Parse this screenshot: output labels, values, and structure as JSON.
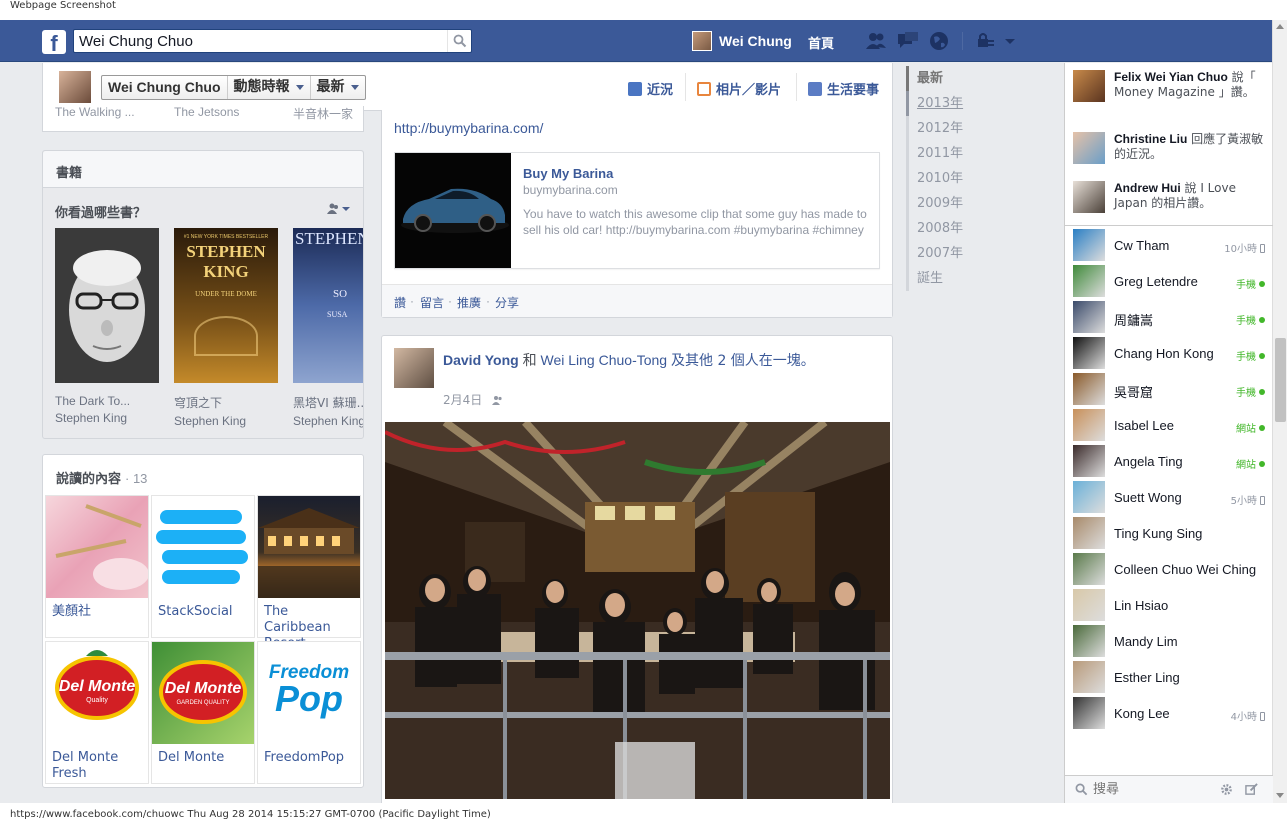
{
  "caption": "Webpage Screenshot",
  "statusline": "https://www.facebook.com/chuowc Thu Aug 28 2014 15:15:27 GMT-0700 (Pacific Daylight Time)",
  "colors": {
    "brand_blue": "#3b5998",
    "link": "#3b5998",
    "online_green": "#42b72a"
  },
  "topbar": {
    "logo": "f",
    "search_value": "Wei Chung Chuo",
    "user_name": "Wei Chung",
    "home_label": "首頁",
    "icons": [
      "friend-requests-icon",
      "messages-icon",
      "notifications-globe-icon",
      "privacy-shortcuts-icon",
      "account-menu-caret-icon"
    ]
  },
  "timeline_header": {
    "name": "Wei Chung Chuo",
    "menu_activity": "動態時報",
    "menu_sort": "最新",
    "nav_status": "近況",
    "nav_photo": "相片／影片",
    "nav_life_event": "生活要事"
  },
  "cutoff_row": [
    "The Walking ...",
    "The Jetsons",
    "半音林一家"
  ],
  "books": {
    "title": "書籍",
    "question": "你看過哪些書？",
    "items": [
      {
        "title": "The Dark To...",
        "author": "Stephen King"
      },
      {
        "title": "穹頂之下",
        "author": "Stephen King",
        "cover_top": "#1 NEW YORK TIMES BESTSELLER",
        "cover_name": "STEPHEN KING",
        "cover_sub": "UNDER THE DOME"
      },
      {
        "title": "黑塔VI 蘇珊...",
        "author": "Stephen King",
        "cover_name": "STEPHEN KIN",
        "cover_sub": "SO",
        "cover_sub2": "SUSA"
      }
    ]
  },
  "reads": {
    "title": "說讀的內容",
    "count": "· 13",
    "items": [
      {
        "label": "美顏社"
      },
      {
        "label": "StackSocial"
      },
      {
        "label": "The Caribbean Resort, ·····"
      },
      {
        "label": "Del Monte Fresh",
        "logo": "Del Monte",
        "logo_sub": "Quality"
      },
      {
        "label": "Del Monte",
        "logo": "Del Monte",
        "logo_sub": "GARDEN QUALITY"
      },
      {
        "label": "FreedomPop",
        "logo": "Freedom",
        "logo2": "Pop"
      }
    ]
  },
  "post1": {
    "url": "http://buymybarina.com/",
    "card_title": "Buy My Barina",
    "card_domain": "buymybarina.com",
    "card_desc": "You have to watch this awesome clip that some guy has made to sell his old car! http://buymybarina.com #buymybarina #chimney",
    "actions": [
      "讚",
      "留言",
      "推廣",
      "分享"
    ]
  },
  "post2": {
    "author": "David Yong",
    "with_text": "和",
    "with_name": "Wei Ling Chuo-Tong",
    "others": "及其他 2 個人在一塊。",
    "date": "2月4日"
  },
  "years": [
    "最新",
    "2013年",
    "2012年",
    "2011年",
    "2010年",
    "2009年",
    "2008年",
    "2007年",
    "誕生"
  ],
  "ticker": [
    {
      "name": "Felix Wei Yian Chuo",
      "text": "說「 Money Magazine 」讚。"
    },
    {
      "name": "Christine Liu",
      "text": "回應了黃淑敏的近況。"
    },
    {
      "name": "Andrew Hui",
      "text": "說 I Love Japan 的相片讚。"
    }
  ],
  "buddies": [
    {
      "name": "Cw Tham",
      "status": "10小時",
      "kind": "idle"
    },
    {
      "name": "Greg Letendre",
      "status": "手機",
      "kind": "mobile"
    },
    {
      "name": "周鏞嵩",
      "status": "手機",
      "kind": "mobile"
    },
    {
      "name": "Chang Hon Kong",
      "status": "手機",
      "kind": "mobile"
    },
    {
      "name": "吳哥窟",
      "status": "手機",
      "kind": "mobile"
    },
    {
      "name": "Isabel Lee",
      "status": "網站",
      "kind": "web"
    },
    {
      "name": "Angela Ting",
      "status": "網站",
      "kind": "web"
    },
    {
      "name": "Suett Wong",
      "status": "5小時",
      "kind": "idle"
    },
    {
      "name": "Ting Kung Sing",
      "status": "",
      "kind": "none"
    },
    {
      "name": "Colleen Chuo Wei Ching",
      "status": "",
      "kind": "none"
    },
    {
      "name": "Lin Hsiao",
      "status": "",
      "kind": "none"
    },
    {
      "name": "Mandy Lim",
      "status": "",
      "kind": "none"
    },
    {
      "name": "Esther Ling",
      "status": "",
      "kind": "none"
    },
    {
      "name": "Kong Lee",
      "status": "4小時",
      "kind": "idle"
    }
  ],
  "chat_search_placeholder": "搜尋"
}
